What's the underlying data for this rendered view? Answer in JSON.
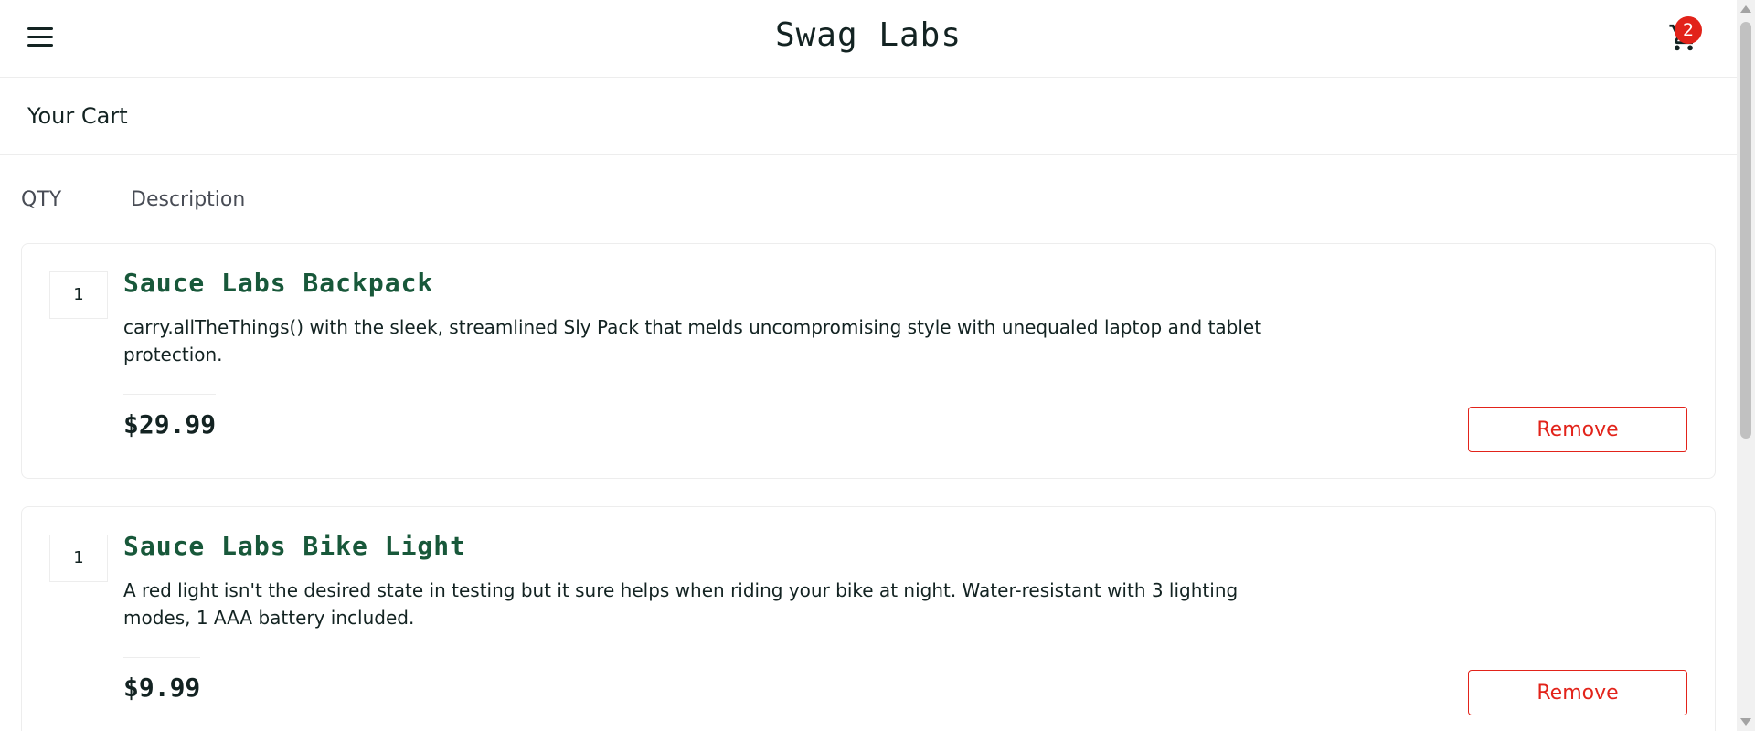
{
  "header": {
    "logo": "Swag Labs",
    "cart_badge": "2"
  },
  "secondary_header": {
    "title": "Your Cart"
  },
  "cart": {
    "labels": {
      "qty": "QTY",
      "description": "Description"
    },
    "items": [
      {
        "quantity": "1",
        "name": "Sauce Labs Backpack",
        "description": "carry.allTheThings() with the sleek, streamlined Sly Pack that melds uncompromising style with unequaled laptop and tablet protection.",
        "price": "$29.99",
        "remove_label": "Remove"
      },
      {
        "quantity": "1",
        "name": "Sauce Labs Bike Light",
        "description": "A red light isn't the desired state in testing but it sure helps when riding your bike at night. Water-resistant with 3 lighting modes, 1 AAA battery included.",
        "price": "$9.99",
        "remove_label": "Remove"
      }
    ]
  },
  "icons": {
    "menu": "hamburger-menu-icon",
    "cart": "shopping-cart-icon"
  },
  "colors": {
    "item_name": "#18583a",
    "remove": "#e2231a",
    "badge": "#e2231a",
    "text": "#132322"
  }
}
